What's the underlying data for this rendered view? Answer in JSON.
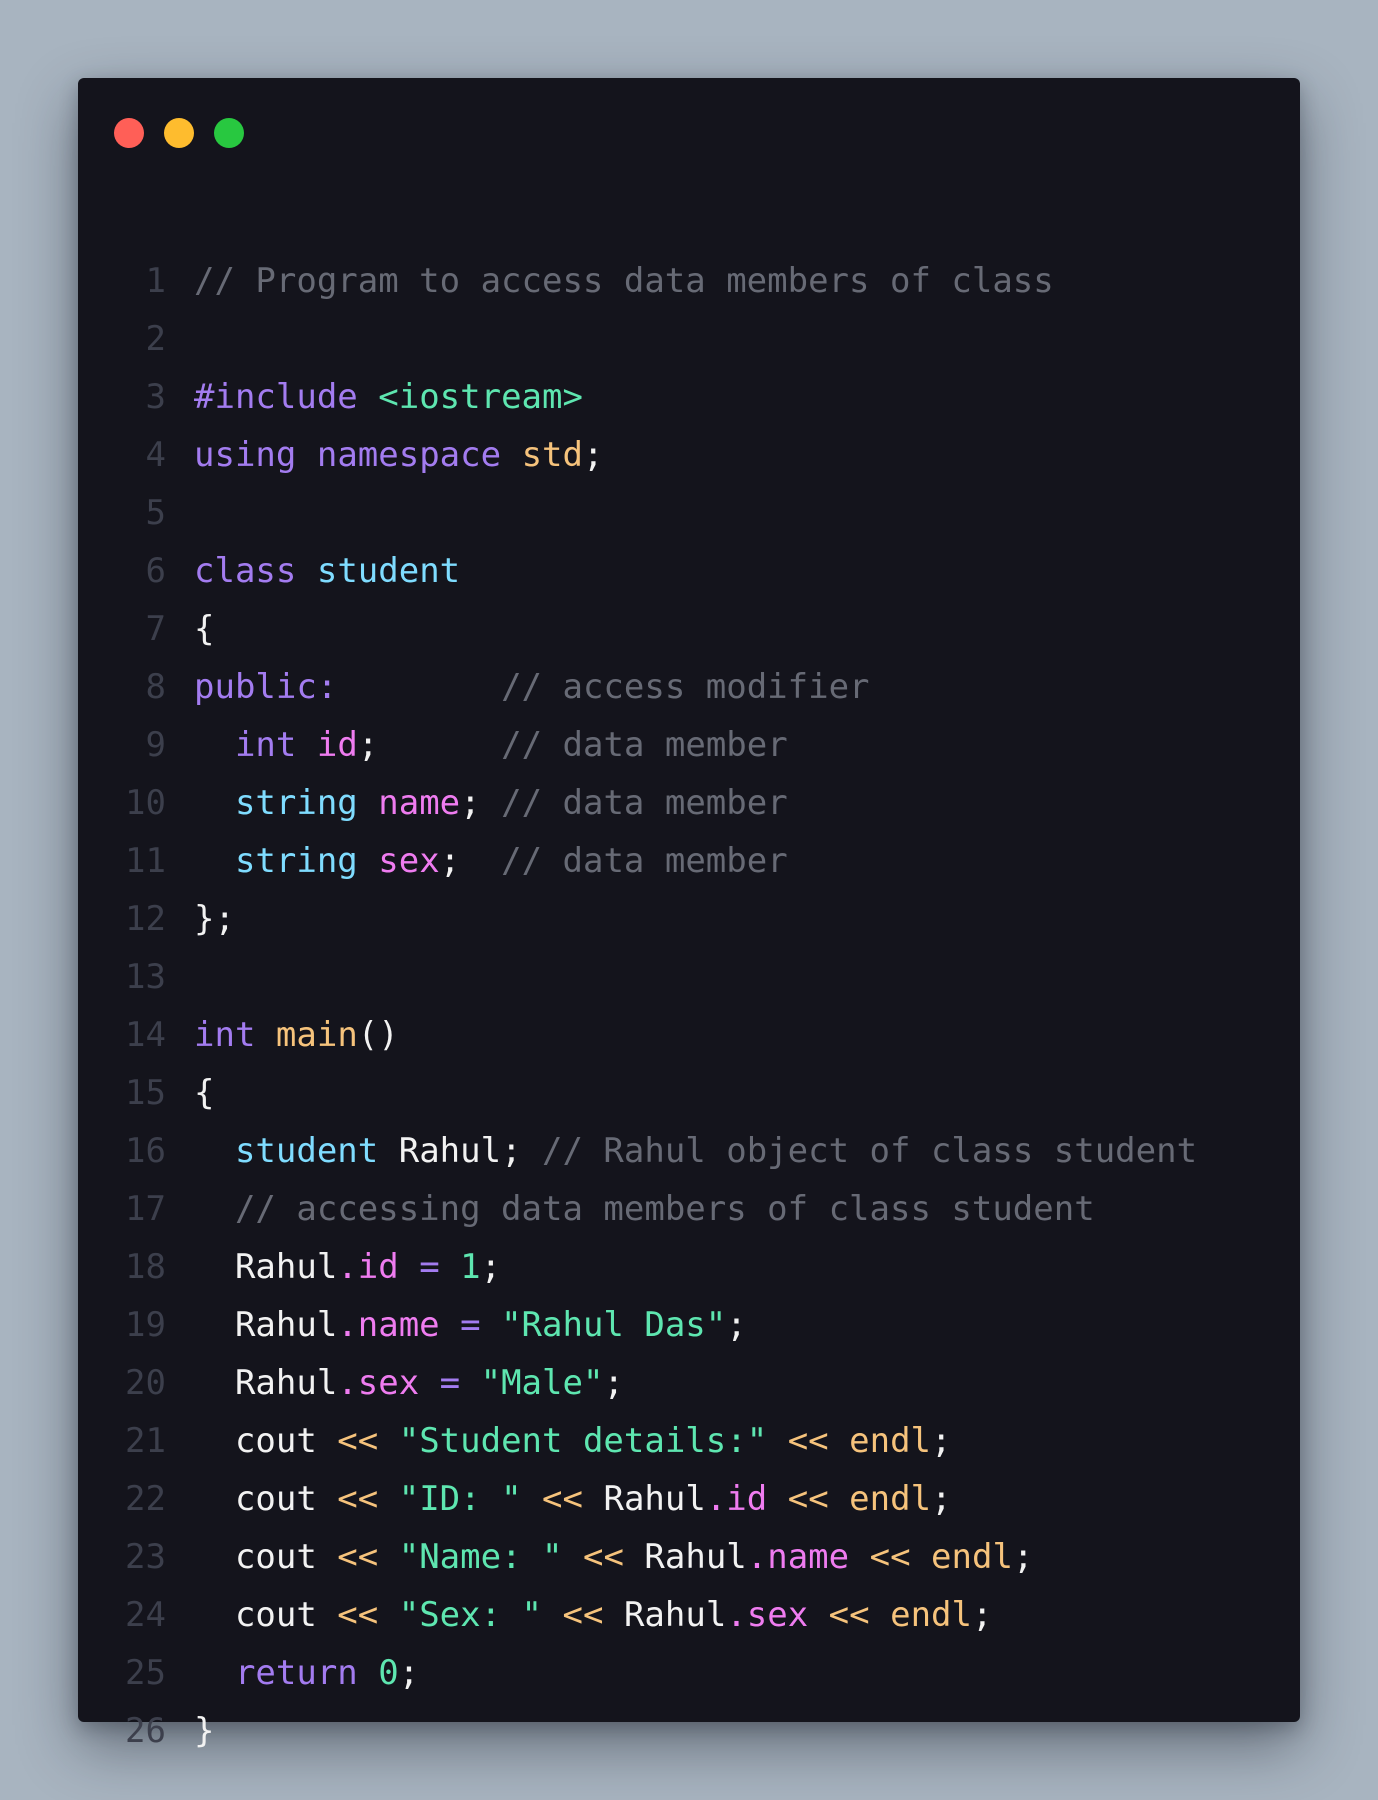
{
  "colors": {
    "background": "#a8b4c0",
    "editor_background": "#14141c",
    "close_dot": "#ff5f57",
    "minimize_dot": "#febc2e",
    "maximize_dot": "#28c840",
    "line_number": "#3c3f4c",
    "comment": "#676a75",
    "keyword": "#a37cf0",
    "string": "#5ee6b0",
    "type": "#7fdcff",
    "member": "#ef7cf0",
    "function": "#f6c37c",
    "plain": "#f2f2f2"
  },
  "window_controls": [
    {
      "name": "close-button",
      "color": "#ff5f57"
    },
    {
      "name": "minimize-button",
      "color": "#febc2e"
    },
    {
      "name": "maximize-button",
      "color": "#28c840"
    }
  ],
  "code": {
    "lines": [
      {
        "number": "1",
        "tokens": [
          {
            "text": "// Program to access data members of class",
            "kind": "comment"
          }
        ]
      },
      {
        "number": "2",
        "tokens": []
      },
      {
        "number": "3",
        "tokens": [
          {
            "text": "#include",
            "kind": "preproc"
          },
          {
            "text": " ",
            "kind": "plain"
          },
          {
            "text": "<iostream>",
            "kind": "header"
          }
        ]
      },
      {
        "number": "4",
        "tokens": [
          {
            "text": "using",
            "kind": "keyword"
          },
          {
            "text": " ",
            "kind": "plain"
          },
          {
            "text": "namespace",
            "kind": "keyword"
          },
          {
            "text": " ",
            "kind": "plain"
          },
          {
            "text": "std",
            "kind": "namespace"
          },
          {
            "text": ";",
            "kind": "punct"
          }
        ]
      },
      {
        "number": "5",
        "tokens": []
      },
      {
        "number": "6",
        "tokens": [
          {
            "text": "class",
            "kind": "keyword"
          },
          {
            "text": " ",
            "kind": "plain"
          },
          {
            "text": "student",
            "kind": "type"
          }
        ]
      },
      {
        "number": "7",
        "tokens": [
          {
            "text": "{",
            "kind": "punct"
          }
        ]
      },
      {
        "number": "8",
        "tokens": [
          {
            "text": "public:",
            "kind": "keyword"
          },
          {
            "text": "        ",
            "kind": "plain"
          },
          {
            "text": "// access modifier",
            "kind": "comment"
          }
        ]
      },
      {
        "number": "9",
        "tokens": [
          {
            "text": "  ",
            "kind": "plain"
          },
          {
            "text": "int",
            "kind": "keyword"
          },
          {
            "text": " ",
            "kind": "plain"
          },
          {
            "text": "id",
            "kind": "member"
          },
          {
            "text": ";",
            "kind": "punct"
          },
          {
            "text": "      ",
            "kind": "plain"
          },
          {
            "text": "// data member",
            "kind": "comment"
          }
        ]
      },
      {
        "number": "10",
        "tokens": [
          {
            "text": "  ",
            "kind": "plain"
          },
          {
            "text": "string",
            "kind": "type"
          },
          {
            "text": " ",
            "kind": "plain"
          },
          {
            "text": "name",
            "kind": "member"
          },
          {
            "text": "; ",
            "kind": "punct"
          },
          {
            "text": "// data member",
            "kind": "comment"
          }
        ]
      },
      {
        "number": "11",
        "tokens": [
          {
            "text": "  ",
            "kind": "plain"
          },
          {
            "text": "string",
            "kind": "type"
          },
          {
            "text": " ",
            "kind": "plain"
          },
          {
            "text": "sex",
            "kind": "member"
          },
          {
            "text": ";  ",
            "kind": "punct"
          },
          {
            "text": "// data member",
            "kind": "comment"
          }
        ]
      },
      {
        "number": "12",
        "tokens": [
          {
            "text": "};",
            "kind": "punct"
          }
        ]
      },
      {
        "number": "13",
        "tokens": []
      },
      {
        "number": "14",
        "tokens": [
          {
            "text": "int",
            "kind": "keyword"
          },
          {
            "text": " ",
            "kind": "plain"
          },
          {
            "text": "main",
            "kind": "func"
          },
          {
            "text": "()",
            "kind": "punct"
          }
        ]
      },
      {
        "number": "15",
        "tokens": [
          {
            "text": "{",
            "kind": "punct"
          }
        ]
      },
      {
        "number": "16",
        "tokens": [
          {
            "text": "  ",
            "kind": "plain"
          },
          {
            "text": "student",
            "kind": "type"
          },
          {
            "text": " Rahul; ",
            "kind": "plain"
          },
          {
            "text": "// Rahul object of class student",
            "kind": "comment"
          }
        ]
      },
      {
        "number": "17",
        "tokens": [
          {
            "text": "  ",
            "kind": "plain"
          },
          {
            "text": "// accessing data members of class student",
            "kind": "comment"
          }
        ]
      },
      {
        "number": "18",
        "tokens": [
          {
            "text": "  Rahul",
            "kind": "plain"
          },
          {
            "text": ".id",
            "kind": "member"
          },
          {
            "text": " = ",
            "kind": "keyword"
          },
          {
            "text": "1",
            "kind": "number"
          },
          {
            "text": ";",
            "kind": "punct"
          }
        ]
      },
      {
        "number": "19",
        "tokens": [
          {
            "text": "  Rahul",
            "kind": "plain"
          },
          {
            "text": ".name",
            "kind": "member"
          },
          {
            "text": " = ",
            "kind": "keyword"
          },
          {
            "text": "\"Rahul Das\"",
            "kind": "string"
          },
          {
            "text": ";",
            "kind": "punct"
          }
        ]
      },
      {
        "number": "20",
        "tokens": [
          {
            "text": "  Rahul",
            "kind": "plain"
          },
          {
            "text": ".sex",
            "kind": "member"
          },
          {
            "text": " = ",
            "kind": "keyword"
          },
          {
            "text": "\"Male\"",
            "kind": "string"
          },
          {
            "text": ";",
            "kind": "punct"
          }
        ]
      },
      {
        "number": "21",
        "tokens": [
          {
            "text": "  cout ",
            "kind": "plain"
          },
          {
            "text": "<<",
            "kind": "operator"
          },
          {
            "text": " ",
            "kind": "plain"
          },
          {
            "text": "\"Student details:\"",
            "kind": "string"
          },
          {
            "text": " ",
            "kind": "plain"
          },
          {
            "text": "<<",
            "kind": "operator"
          },
          {
            "text": " ",
            "kind": "plain"
          },
          {
            "text": "endl",
            "kind": "func"
          },
          {
            "text": ";",
            "kind": "punct"
          }
        ]
      },
      {
        "number": "22",
        "tokens": [
          {
            "text": "  cout ",
            "kind": "plain"
          },
          {
            "text": "<<",
            "kind": "operator"
          },
          {
            "text": " ",
            "kind": "plain"
          },
          {
            "text": "\"ID: \"",
            "kind": "string"
          },
          {
            "text": " ",
            "kind": "plain"
          },
          {
            "text": "<<",
            "kind": "operator"
          },
          {
            "text": " Rahul",
            "kind": "plain"
          },
          {
            "text": ".id",
            "kind": "member"
          },
          {
            "text": " ",
            "kind": "plain"
          },
          {
            "text": "<<",
            "kind": "operator"
          },
          {
            "text": " ",
            "kind": "plain"
          },
          {
            "text": "endl",
            "kind": "func"
          },
          {
            "text": ";",
            "kind": "punct"
          }
        ]
      },
      {
        "number": "23",
        "tokens": [
          {
            "text": "  cout ",
            "kind": "plain"
          },
          {
            "text": "<<",
            "kind": "operator"
          },
          {
            "text": " ",
            "kind": "plain"
          },
          {
            "text": "\"Name: \"",
            "kind": "string"
          },
          {
            "text": " ",
            "kind": "plain"
          },
          {
            "text": "<<",
            "kind": "operator"
          },
          {
            "text": " Rahul",
            "kind": "plain"
          },
          {
            "text": ".name",
            "kind": "member"
          },
          {
            "text": " ",
            "kind": "plain"
          },
          {
            "text": "<<",
            "kind": "operator"
          },
          {
            "text": " ",
            "kind": "plain"
          },
          {
            "text": "endl",
            "kind": "func"
          },
          {
            "text": ";",
            "kind": "punct"
          }
        ]
      },
      {
        "number": "24",
        "tokens": [
          {
            "text": "  cout ",
            "kind": "plain"
          },
          {
            "text": "<<",
            "kind": "operator"
          },
          {
            "text": " ",
            "kind": "plain"
          },
          {
            "text": "\"Sex: \"",
            "kind": "string"
          },
          {
            "text": " ",
            "kind": "plain"
          },
          {
            "text": "<<",
            "kind": "operator"
          },
          {
            "text": " Rahul",
            "kind": "plain"
          },
          {
            "text": ".sex",
            "kind": "member"
          },
          {
            "text": " ",
            "kind": "plain"
          },
          {
            "text": "<<",
            "kind": "operator"
          },
          {
            "text": " ",
            "kind": "plain"
          },
          {
            "text": "endl",
            "kind": "func"
          },
          {
            "text": ";",
            "kind": "punct"
          }
        ]
      },
      {
        "number": "25",
        "tokens": [
          {
            "text": "  ",
            "kind": "plain"
          },
          {
            "text": "return",
            "kind": "keyword"
          },
          {
            "text": " ",
            "kind": "plain"
          },
          {
            "text": "0",
            "kind": "number"
          },
          {
            "text": ";",
            "kind": "punct"
          }
        ]
      },
      {
        "number": "26",
        "tokens": [
          {
            "text": "}",
            "kind": "punct"
          }
        ]
      }
    ]
  }
}
